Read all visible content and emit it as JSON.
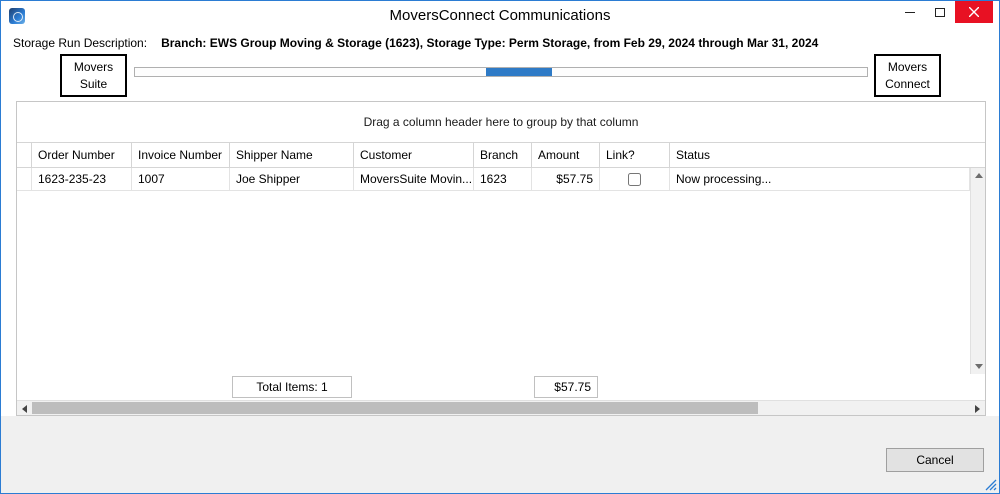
{
  "window": {
    "title": "MoversConnect Communications"
  },
  "header": {
    "label": "Storage Run Description:",
    "description": "Branch: EWS Group Moving & Storage (1623), Storage Type: Perm Storage, from Feb 29, 2024 through Mar 31, 2024"
  },
  "transfer": {
    "source_label": "Movers Suite",
    "target_label": "Movers Connect",
    "progress": {
      "left_percent": 48,
      "width_percent": 9
    }
  },
  "grid": {
    "group_hint": "Drag a column header here to group by that column",
    "columns": [
      "Order Number",
      "Invoice Number",
      "Shipper Name",
      "Customer",
      "Branch",
      "Amount",
      "Link?",
      "Status"
    ],
    "rows": [
      {
        "order_number": "1623-235-23",
        "invoice_number": "1007",
        "shipper_name": "Joe Shipper",
        "customer": "MoversSuite Movin...",
        "branch": "1623",
        "amount": "$57.75",
        "link_checked": false,
        "status": "Now processing..."
      }
    ],
    "footer": {
      "total_items": "Total Items: 1",
      "total_amount": "$57.75"
    }
  },
  "actions": {
    "cancel": "Cancel"
  },
  "colors": {
    "accent_border": "#2b7cd3",
    "close_button": "#e81123",
    "progress_fill": "#2e7ac6"
  }
}
